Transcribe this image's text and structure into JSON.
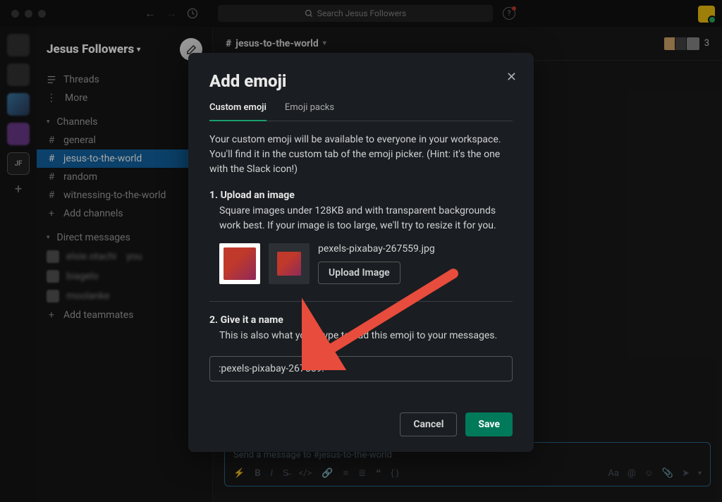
{
  "titlebar": {
    "search_placeholder": "Search Jesus Followers"
  },
  "sidebar": {
    "workspace_name": "Jesus Followers",
    "threads": "Threads",
    "more": "More",
    "channels_label": "Channels",
    "channels": [
      {
        "name": "general"
      },
      {
        "name": "jesus-to-the-world"
      },
      {
        "name": "random"
      },
      {
        "name": "witnessing-to-the-world"
      }
    ],
    "add_channels": "Add channels",
    "dm_label": "Direct messages",
    "dms": [
      {
        "name": "elsie.otachi",
        "suffix": "you"
      },
      {
        "name": "biagelo"
      },
      {
        "name": "moolanke"
      }
    ],
    "add_teammates": "Add teammates"
  },
  "channel": {
    "prefix": "#",
    "name": "jesus-to-the-world",
    "member_count": "3",
    "composer_placeholder": "Send a message to #jesus-to-the-world"
  },
  "modal": {
    "title": "Add emoji",
    "tab_custom": "Custom emoji",
    "tab_packs": "Emoji packs",
    "intro": "Your custom emoji will be available to everyone in your workspace. You'll find it in the custom tab of the emoji picker. (Hint: it's the one with the Slack icon!)",
    "step1_title": "1. Upload an image",
    "step1_desc": "Square images under 128KB and with transparent backgrounds work best. If your image is too large, we'll try to resize it for you.",
    "filename": "pexels-pixabay-267559.jpg",
    "upload_btn": "Upload Image",
    "step2_title": "2. Give it a name",
    "step2_desc": "This is also what you'll type to add this emoji to your messages.",
    "name_value": ":pexels-pixabay-267559:",
    "cancel": "Cancel",
    "save": "Save"
  },
  "rail": {
    "jf": "JF"
  }
}
